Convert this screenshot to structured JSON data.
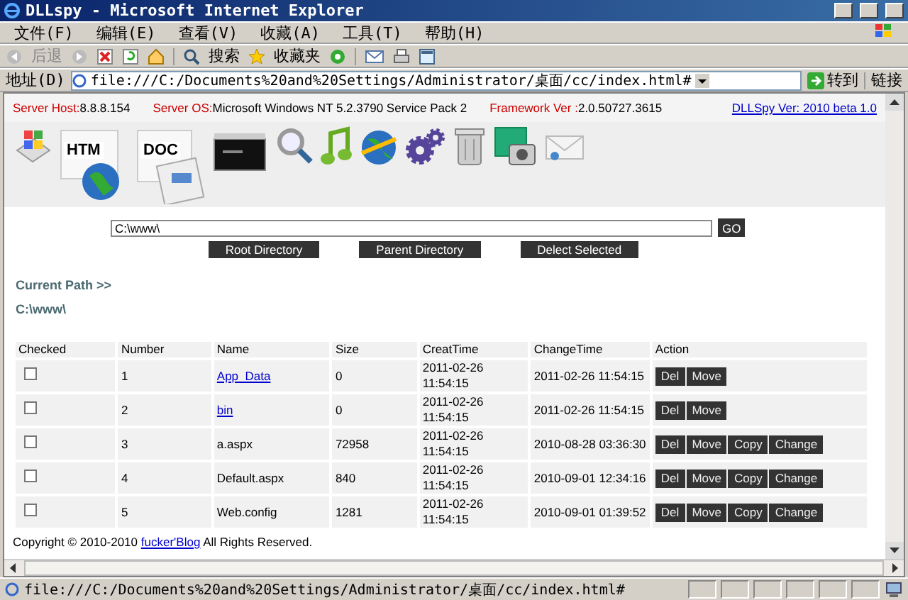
{
  "window": {
    "title": "DLLspy - Microsoft Internet Explorer"
  },
  "menu": [
    "文件(F)",
    "编辑(E)",
    "查看(V)",
    "收藏(A)",
    "工具(T)",
    "帮助(H)"
  ],
  "toolbar": {
    "back": "后退",
    "search": "搜索",
    "favorites": "收藏夹"
  },
  "address": {
    "label": "地址(D)",
    "value": "file:///C:/Documents%20and%20Settings/Administrator/桌面/cc/index.html#",
    "go": "转到",
    "links": "链接"
  },
  "server_info": [
    {
      "label": "Server Host:",
      "value": "8.8.8.154"
    },
    {
      "label": "Server OS:",
      "value": "Microsoft Windows NT 5.2.3790 Service Pack 2"
    },
    {
      "label": "Framework Ver :",
      "value": "2.0.50727.3615"
    }
  ],
  "version_link": "DLLSpy Ver: 2010 beta 1.0",
  "icon_labels": [
    "HTM",
    "DOC"
  ],
  "path_field": {
    "value": "C:\\www\\"
  },
  "go_button": "GO",
  "actions": [
    "Root Directory",
    "Parent Directory",
    "Delect Selected"
  ],
  "current_path": {
    "label": "Current Path >>",
    "value": "C:\\www\\"
  },
  "table": {
    "columns": [
      "Checked",
      "Number",
      "Name",
      "Size",
      "CreatTime",
      "ChangeTime",
      "Action"
    ],
    "rows": [
      {
        "checked": false,
        "number": "1",
        "name": "App_Data",
        "kind": "folder",
        "size": "0",
        "created": "2011-02-26 11:54:15",
        "changed": "2011-02-26 11:54:15",
        "actions": [
          "Del",
          "Move"
        ]
      },
      {
        "checked": false,
        "number": "2",
        "name": "bin",
        "kind": "folder",
        "size": "0",
        "created": "2011-02-26 11:54:15",
        "changed": "2011-02-26 11:54:15",
        "actions": [
          "Del",
          "Move"
        ]
      },
      {
        "checked": false,
        "number": "3",
        "name": "a.aspx",
        "kind": "file",
        "size": "72958",
        "created": "2011-02-26 11:54:15",
        "changed": "2010-08-28 03:36:30",
        "actions": [
          "Del",
          "Move",
          "Copy",
          "Change"
        ]
      },
      {
        "checked": false,
        "number": "4",
        "name": "Default.aspx",
        "kind": "file",
        "size": "840",
        "created": "2011-02-26 11:54:15",
        "changed": "2010-09-01 12:34:16",
        "actions": [
          "Del",
          "Move",
          "Copy",
          "Change"
        ]
      },
      {
        "checked": false,
        "number": "5",
        "name": "Web.config",
        "kind": "file",
        "size": "1281",
        "created": "2011-02-26 11:54:15",
        "changed": "2010-09-01 01:39:52",
        "actions": [
          "Del",
          "Move",
          "Copy",
          "Change"
        ]
      }
    ]
  },
  "footer": {
    "before": "Copyright © 2010-2010",
    "link": "fucker'Blog",
    "after": "All Rights Reserved."
  },
  "status_bar": {
    "text": "file:///C:/Documents%20and%20Settings/Administrator/桌面/cc/index.html#"
  }
}
